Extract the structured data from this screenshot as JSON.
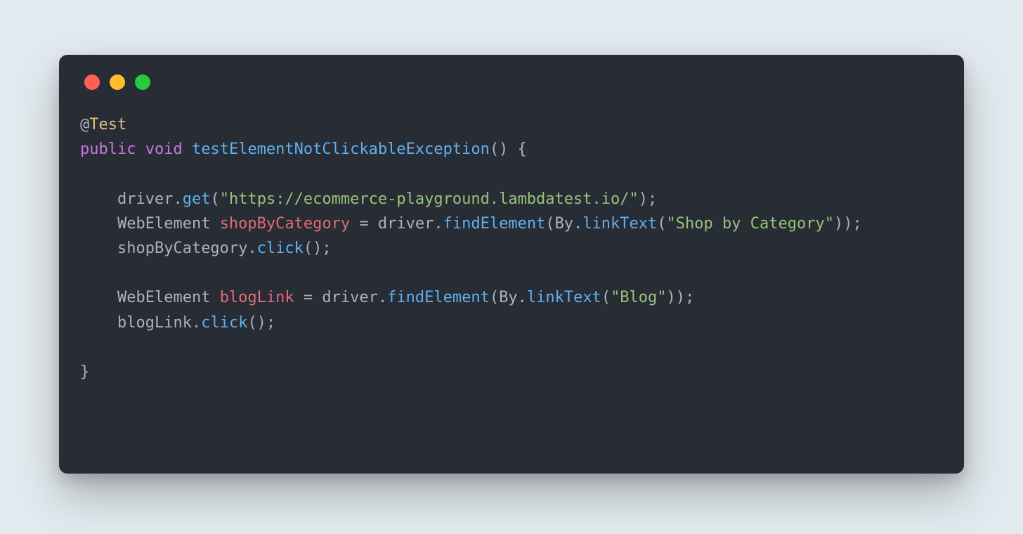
{
  "code": {
    "annotation_at": "@",
    "annotation_name": "Test",
    "kw_public": "public",
    "kw_void": "void",
    "method_name": "testElementNotClickableException",
    "l3_driver": "driver",
    "l3_get": "get",
    "l3_url": "\"https://ecommerce-playground.lambdatest.io/\"",
    "l4_type": "WebElement",
    "l4_var": "shopByCategory",
    "l4_driver": "driver",
    "l4_find": "findElement",
    "l4_by": "By",
    "l4_linkText": "linkText",
    "l4_arg": "\"Shop by Category\"",
    "l5_var": "shopByCategory",
    "l5_click": "click",
    "l7_type": "WebElement",
    "l7_var": "blogLink",
    "l7_driver": "driver",
    "l7_find": "findElement",
    "l7_by": "By",
    "l7_linkText": "linkText",
    "l7_arg": "\"Blog\"",
    "l8_var": "blogLink",
    "l8_click": "click"
  },
  "trafficLights": {
    "red": "close",
    "yellow": "minimize",
    "green": "zoom"
  }
}
